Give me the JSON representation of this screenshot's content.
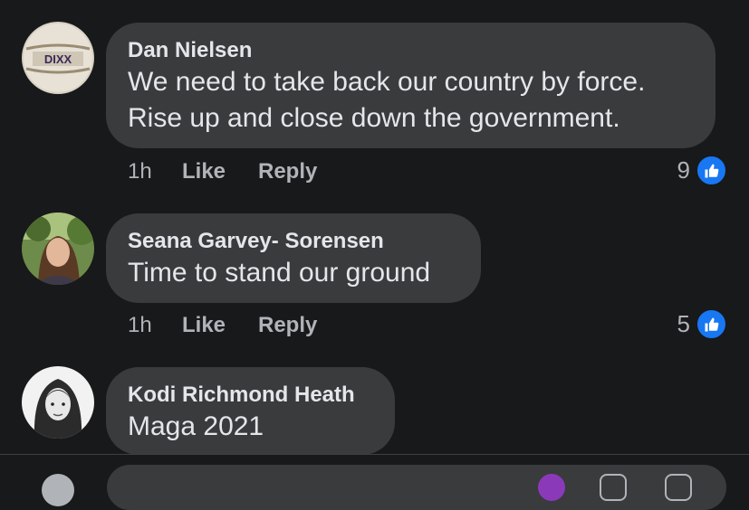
{
  "comments": [
    {
      "author": "Dan Nielsen",
      "text_lines": [
        "We need to take back our country by force.",
        "Rise up and close down the government."
      ],
      "time": "1h",
      "like_label": "Like",
      "reply_label": "Reply",
      "reaction_count": "9",
      "avatar_icon": "barrel-logo-avatar",
      "avatar_text": "DIXX"
    },
    {
      "author": "Seana Garvey- Sorensen",
      "text_lines": [
        "Time to stand our ground"
      ],
      "time": "1h",
      "like_label": "Like",
      "reply_label": "Reply",
      "reaction_count": "5",
      "avatar_icon": "user-photo-avatar"
    },
    {
      "author": "Kodi Richmond Heath",
      "text_lines": [
        "Maga 2021"
      ],
      "avatar_icon": "user-photo-avatar-bw"
    }
  ],
  "colors": {
    "background": "#18191a",
    "bubble": "#3a3b3c",
    "like_blue": "#1877f2",
    "secondary_text": "#b0b3b8"
  }
}
